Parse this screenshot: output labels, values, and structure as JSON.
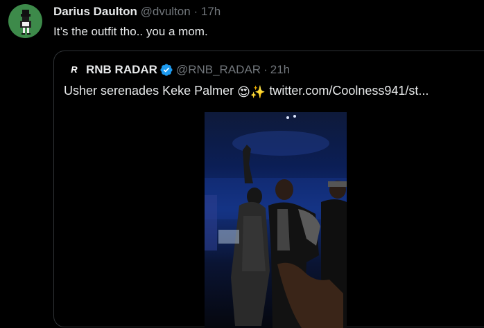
{
  "tweet": {
    "author_name": "Darius Daulton",
    "author_handle": "@dvulton",
    "separator": "·",
    "time": "17h",
    "text": "It’s the outfit tho.. you a mom."
  },
  "quoted": {
    "author_name": "RNB RADAR",
    "author_handle": "@RNB_RADAR",
    "separator": "·",
    "time": "21h",
    "text_before_emoji": "Usher serenades Keke Palmer ",
    "emoji_1": "😍",
    "emoji_2": "✨",
    "link": " twitter.com/Coolness941/st..."
  },
  "colors": {
    "background": "#000000",
    "text": "#e7e9ea",
    "muted": "#71767b",
    "border": "#2f3336",
    "verified": "#1d9bf0",
    "avatar_bg": "#3d8a4a"
  },
  "icons": {
    "verified": "verified-badge-icon",
    "quote_logo": "rnb-radar-logo-icon"
  }
}
